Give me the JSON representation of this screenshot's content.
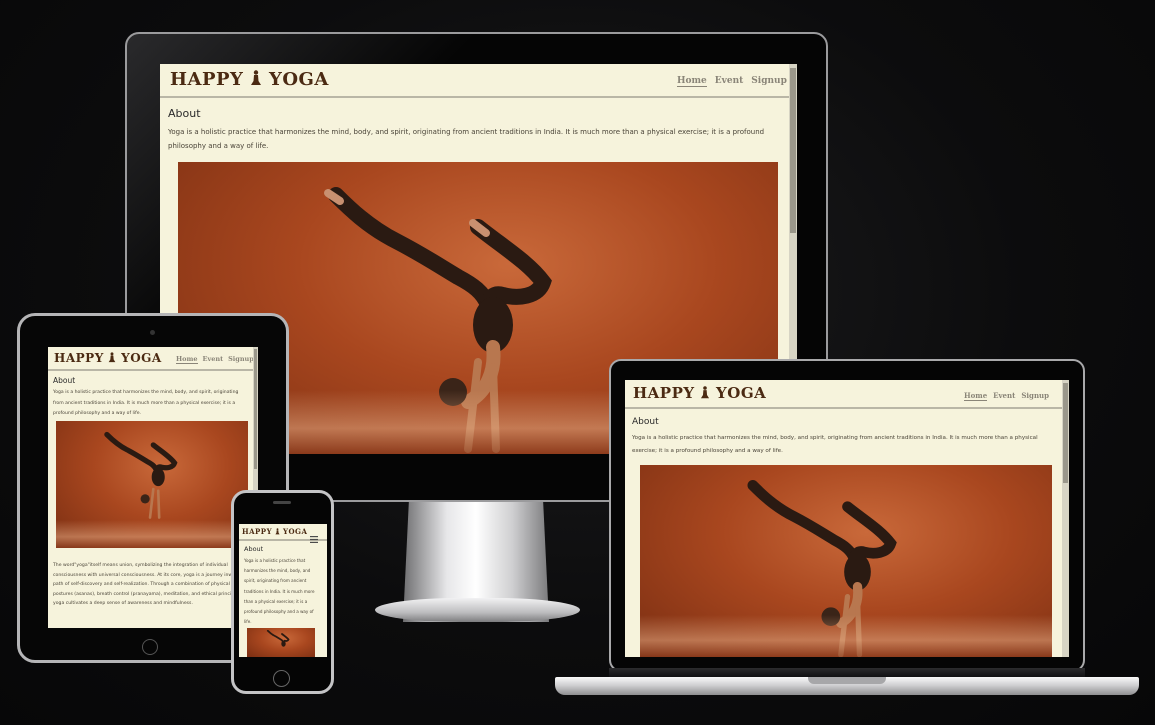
{
  "site": {
    "brand_left": "HAPPY",
    "brand_right": "YOGA",
    "nav": [
      "Home",
      "Event",
      "Signup"
    ],
    "about_heading": "About",
    "about_text": "Yoga is a holistic practice that harmonizes the mind, body, and spirit, originating from ancient traditions in India. It is much more than a physical exercise; it is a profound philosophy and a way of life.",
    "extra_text": "The word\"yoga\"itself means union, symbolizing the integration of individual consciousness with universal consciousness. At its core, yoga is a journey inward, a path of self-discovery and self-realization. Through a combination of physical postures (asanas), breath control (pranayama), meditation, and ethical principles, yoga cultivates a deep sense of awareness and mindfulness."
  },
  "colors": {
    "page_bg": "#f6f3dc",
    "brand": "#4b2a12",
    "nav": "#8a8578",
    "photo": "#a9471f",
    "backdrop": "#0c0c0d"
  },
  "icons": {
    "brand": "yoga-figure-icon",
    "menu": "hamburger-menu-icon"
  }
}
